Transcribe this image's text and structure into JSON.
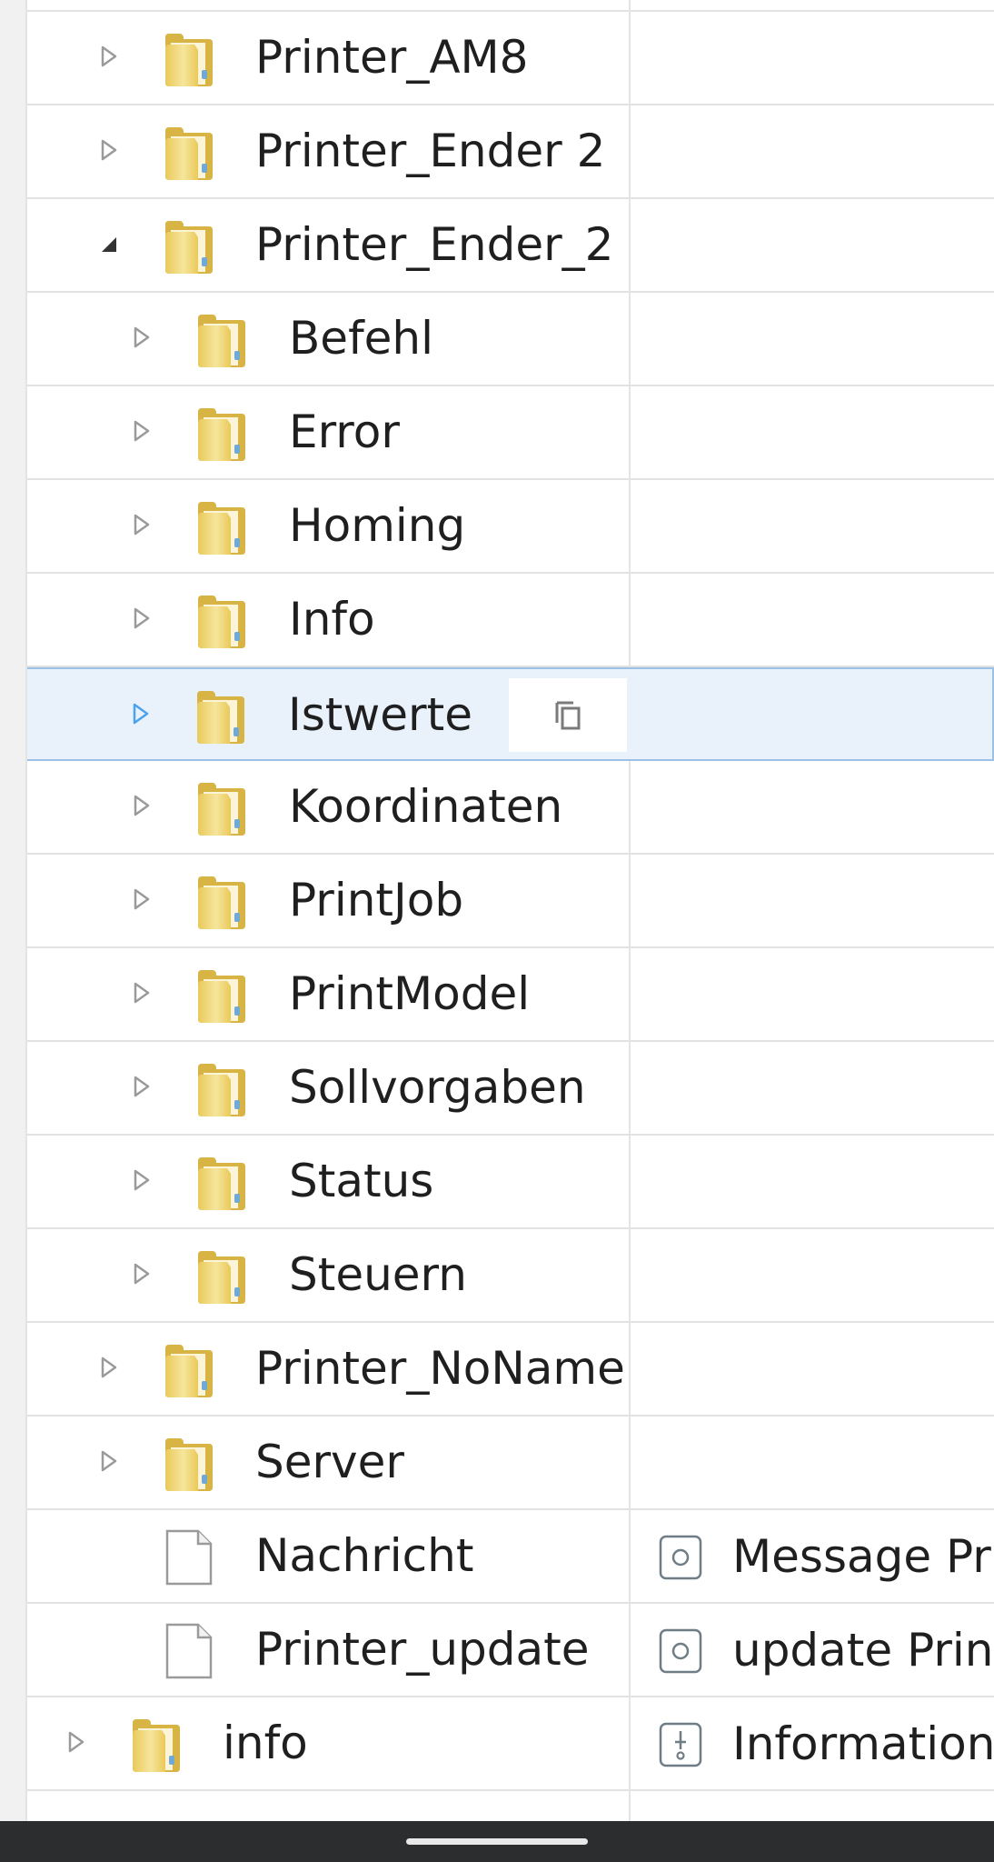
{
  "tree": {
    "rows": [
      {
        "label": "Printer_AM8",
        "level": 1,
        "type": "folder",
        "expander": "collapsed"
      },
      {
        "label": "Printer_Ender 2",
        "level": 1,
        "type": "folder",
        "expander": "collapsed"
      },
      {
        "label": "Printer_Ender_2",
        "level": 1,
        "type": "folder",
        "expander": "expanded"
      },
      {
        "label": "Befehl",
        "level": 2,
        "type": "folder",
        "expander": "collapsed"
      },
      {
        "label": "Error",
        "level": 2,
        "type": "folder",
        "expander": "collapsed"
      },
      {
        "label": "Homing",
        "level": 2,
        "type": "folder",
        "expander": "collapsed"
      },
      {
        "label": "Info",
        "level": 2,
        "type": "folder",
        "expander": "collapsed"
      },
      {
        "label": "Istwerte",
        "level": 2,
        "type": "folder",
        "expander": "collapsed",
        "selected": true,
        "action_icon": "copy-icon"
      },
      {
        "label": "Koordinaten",
        "level": 2,
        "type": "folder",
        "expander": "collapsed"
      },
      {
        "label": "PrintJob",
        "level": 2,
        "type": "folder",
        "expander": "collapsed"
      },
      {
        "label": "PrintModel",
        "level": 2,
        "type": "folder",
        "expander": "collapsed"
      },
      {
        "label": "Sollvorgaben",
        "level": 2,
        "type": "folder",
        "expander": "collapsed"
      },
      {
        "label": "Status",
        "level": 2,
        "type": "folder",
        "expander": "collapsed"
      },
      {
        "label": "Steuern",
        "level": 2,
        "type": "folder",
        "expander": "collapsed"
      },
      {
        "label": "Printer_NoName",
        "level": 1,
        "type": "folder",
        "expander": "collapsed"
      },
      {
        "label": "Server",
        "level": 1,
        "type": "folder",
        "expander": "collapsed"
      },
      {
        "label": "Nachricht",
        "level": 1,
        "type": "file",
        "expander": "none",
        "desc_icon": "state-icon",
        "desc": "Message Pr"
      },
      {
        "label": "Printer_update",
        "level": 1,
        "type": "file",
        "expander": "none",
        "desc_icon": "state-icon",
        "desc": "update Print"
      },
      {
        "label": "info",
        "level": 0,
        "type": "folder",
        "expander": "collapsed",
        "desc_icon": "info-state-icon",
        "desc": "Information"
      },
      {
        "label": "",
        "level": 0,
        "type": "folder",
        "expander": "none",
        "desc_icon": "host-icon",
        "desc": "",
        "partial": true
      }
    ]
  },
  "colors": {
    "folder": "#e9c95a",
    "folder_light": "#f6e59c",
    "selection_bg": "#e9f1fb",
    "selection_border": "#9cc1e6",
    "expander_selected": "#4aa3ee",
    "nav_bar": "#2c2d2f"
  }
}
